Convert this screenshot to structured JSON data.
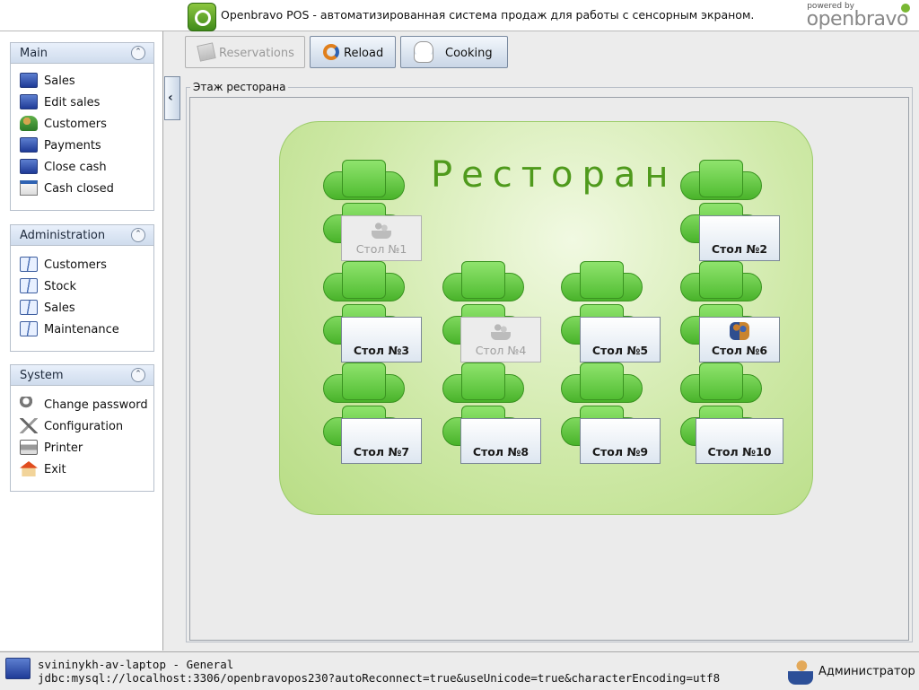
{
  "app": {
    "title": "Openbravo POS - автоматизированная система продаж для работы с сенсорным экраном.",
    "brand_small": "powered by",
    "brand_big": "openbravo"
  },
  "sidebar": {
    "main": {
      "title": "Main",
      "items": [
        {
          "label": "Sales",
          "icon": "monitor-icon"
        },
        {
          "label": "Edit sales",
          "icon": "monitor-icon"
        },
        {
          "label": "Customers",
          "icon": "customers-icon"
        },
        {
          "label": "Payments",
          "icon": "monitor-icon"
        },
        {
          "label": "Close cash",
          "icon": "monitor-icon"
        },
        {
          "label": "Cash closed",
          "icon": "calendar-icon"
        }
      ]
    },
    "administration": {
      "title": "Administration",
      "items": [
        {
          "label": "Customers",
          "icon": "book-icon"
        },
        {
          "label": "Stock",
          "icon": "book-icon"
        },
        {
          "label": "Sales",
          "icon": "book-icon"
        },
        {
          "label": "Maintenance",
          "icon": "book-icon"
        }
      ]
    },
    "system": {
      "title": "System",
      "items": [
        {
          "label": "Change password",
          "icon": "key-icon"
        },
        {
          "label": "Configuration",
          "icon": "tools-icon"
        },
        {
          "label": "Printer",
          "icon": "printer-icon"
        },
        {
          "label": "Exit",
          "icon": "home-icon"
        }
      ]
    }
  },
  "toolbar": {
    "reservations": "Reservations",
    "reload": "Reload",
    "cooking": "Cooking"
  },
  "floor": {
    "legend": "Этаж ресторана",
    "title": "Ресторан",
    "tables": [
      {
        "name": "Стол №1",
        "state": "disabled",
        "icon": "guests-gray-icon"
      },
      {
        "name": "Стол №2",
        "state": "free"
      },
      {
        "name": "Стол №3",
        "state": "free"
      },
      {
        "name": "Стол №4",
        "state": "disabled",
        "icon": "guests-gray-icon"
      },
      {
        "name": "Стол №5",
        "state": "free"
      },
      {
        "name": "Стол №6",
        "state": "occupied",
        "icon": "guests-color-icon"
      },
      {
        "name": "Стол №7",
        "state": "free"
      },
      {
        "name": "Стол №8",
        "state": "free"
      },
      {
        "name": "Стол №9",
        "state": "free"
      },
      {
        "name": "Стол №10",
        "state": "free"
      }
    ]
  },
  "status": {
    "host": "svininykh-av-laptop - General",
    "db": "jdbc:mysql://localhost:3306/openbravopos230?autoReconnect=true&useUnicode=true&characterEncoding=utf8",
    "user": "Администратор"
  }
}
